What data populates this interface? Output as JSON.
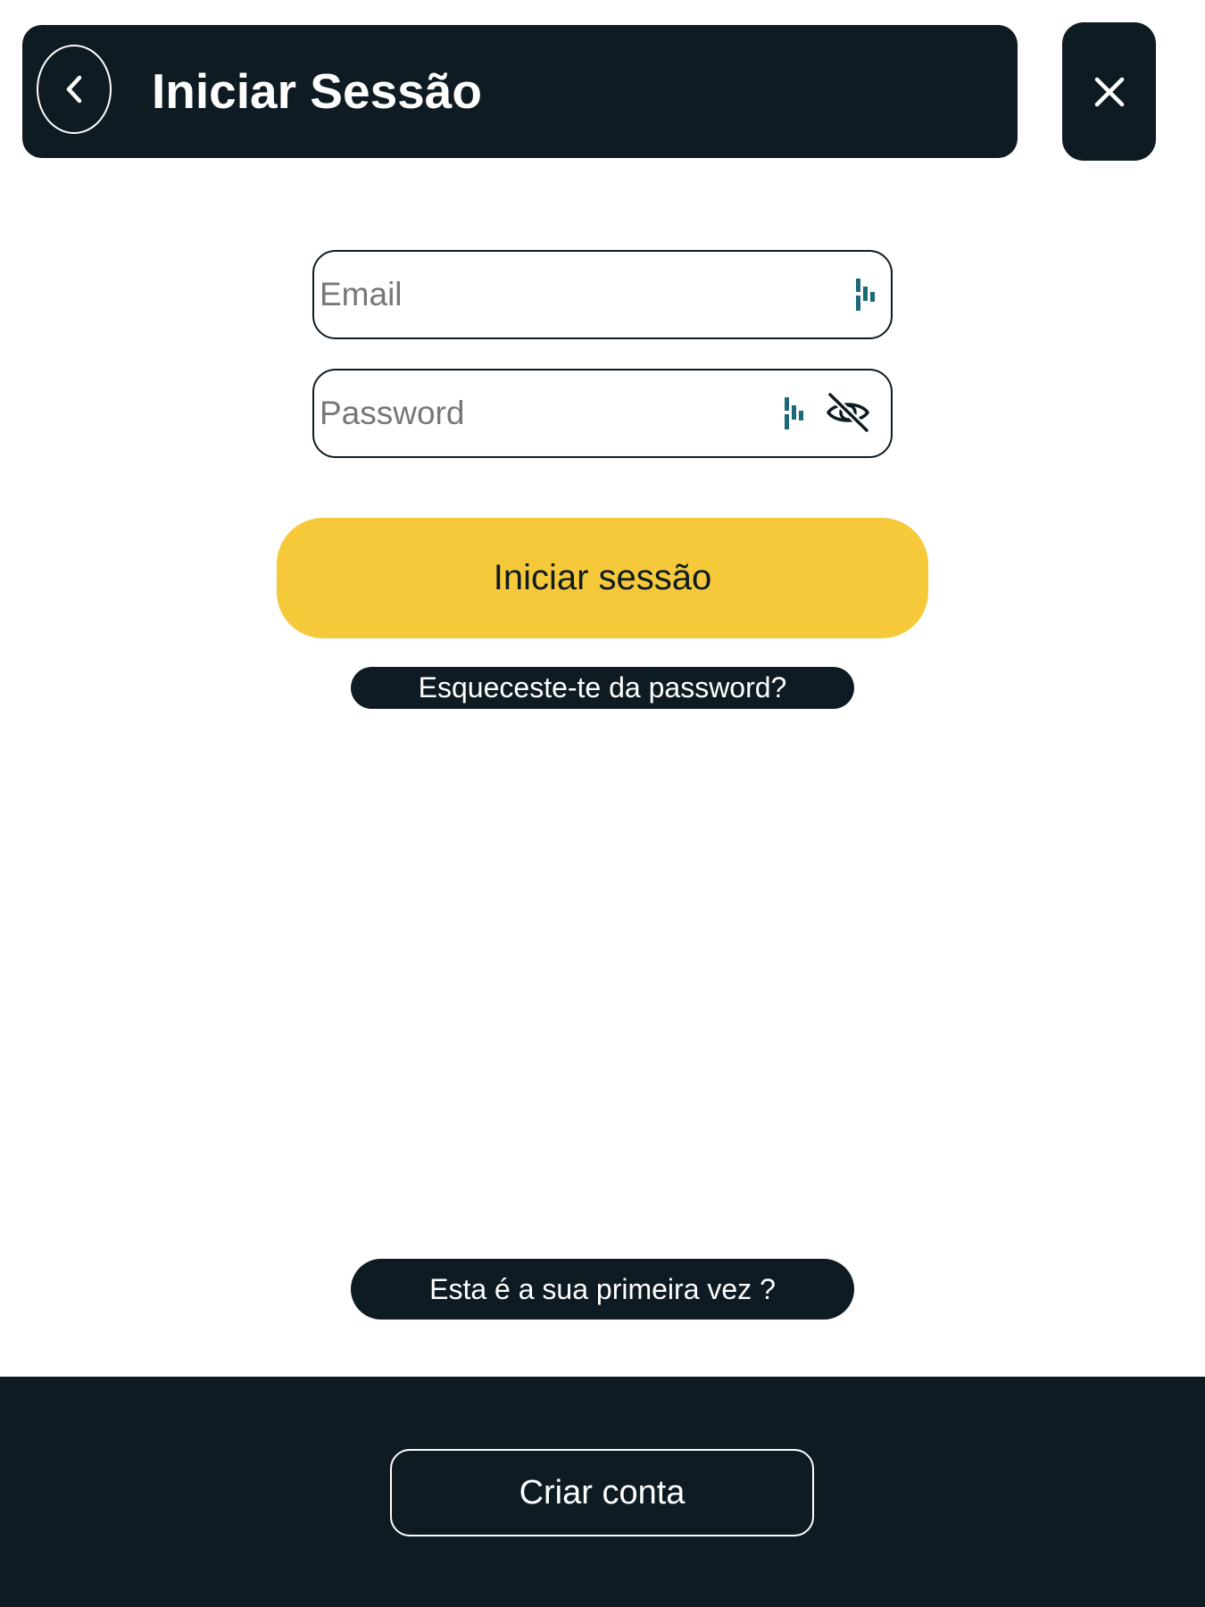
{
  "header": {
    "title": "Iniciar Sessão",
    "back_icon": "chevron-left-icon",
    "close_icon": "close-icon"
  },
  "form": {
    "email": {
      "placeholder": "Email",
      "value": "",
      "autofill_icon": "password-manager-icon"
    },
    "password": {
      "placeholder": "Password",
      "value": "",
      "autofill_icon": "password-manager-icon",
      "visibility_icon": "eye-off-icon"
    },
    "submit_label": "Iniciar sessão",
    "forgot_label": "Esqueceste-te da password?"
  },
  "first_time_label": "Esta é a sua primeira vez ?",
  "footer": {
    "create_account_label": "Criar conta"
  },
  "colors": {
    "dark": "#0e1b22",
    "accent": "#f6c93b",
    "icon_teal": "#1b6a78"
  }
}
